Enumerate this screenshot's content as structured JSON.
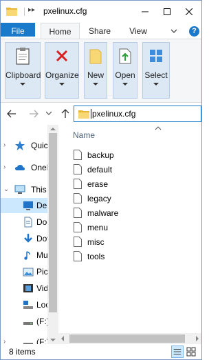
{
  "window": {
    "title": "pxelinux.cfg"
  },
  "ribbon_tabs": {
    "file": "File",
    "home": "Home",
    "share": "Share",
    "view": "View",
    "help": "?"
  },
  "ribbon_groups": {
    "clipboard": "Clipboard",
    "organize": "Organize",
    "new": "New",
    "open": "Open",
    "select": "Select"
  },
  "address": {
    "path": "pxelinux.cfg"
  },
  "nav_pane": {
    "items": [
      {
        "label": "Quick access",
        "icon": "star-icon"
      },
      {
        "label": "OneDrive",
        "icon": "cloud-icon"
      },
      {
        "label": "This PC",
        "icon": "computer-icon"
      },
      {
        "label": "Desktop",
        "icon": "desktop-icon"
      },
      {
        "label": "Documents",
        "icon": "documents-icon"
      },
      {
        "label": "Downloads",
        "icon": "download-icon"
      },
      {
        "label": "Music",
        "icon": "music-icon"
      },
      {
        "label": "Pictures",
        "icon": "pictures-icon"
      },
      {
        "label": "Videos",
        "icon": "videos-icon"
      },
      {
        "label": "Local Disk",
        "icon": "local-disk-icon"
      },
      {
        "label": "(F:)",
        "icon": "drive-icon"
      },
      {
        "label": "(F:)",
        "icon": "drive-icon"
      }
    ]
  },
  "content": {
    "column_name": "Name",
    "files": [
      "backup",
      "default",
      "erase",
      "legacy",
      "malware",
      "menu",
      "misc",
      "tools"
    ]
  },
  "status": {
    "item_count": "8 items"
  },
  "colors": {
    "accent": "#1979ca",
    "ribbon_group": "#dde8f5",
    "selected": "#cce8ff"
  }
}
